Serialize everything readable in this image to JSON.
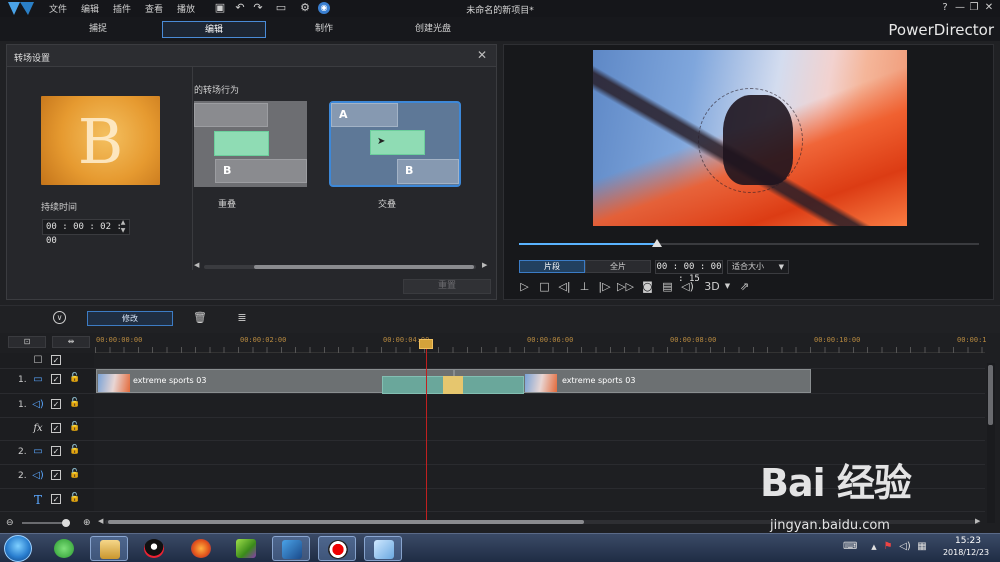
{
  "menu": {
    "items": [
      "文件",
      "编辑",
      "插件",
      "查看",
      "播放"
    ],
    "window_title": "未命名的新项目*",
    "help": "?"
  },
  "modes": {
    "tabs": [
      "捕捉",
      "编辑",
      "制作",
      "创建光盘"
    ],
    "active": "编辑",
    "brand": "PowerDirector"
  },
  "transition_panel": {
    "title": "转场设置",
    "thumb_letter": "B",
    "duration_label": "持续时间",
    "duration_value": "00 : 00 : 02 : 00",
    "behavior_label": "的转场行为",
    "cards": [
      {
        "label": "重叠",
        "block_top": "",
        "block_bottom": "B"
      },
      {
        "label": "交叠",
        "block_top": "A",
        "block_bottom": "B"
      }
    ],
    "selected": "交叠",
    "reset_label": "重置"
  },
  "preview": {
    "progress_fraction": 0.3,
    "mode_clip": "片段",
    "mode_movie": "全片",
    "active_mode": "片段",
    "timecode": "00 : 00 : 00 : 15",
    "fit_label": "适合大小",
    "three_d_label": "3D"
  },
  "toolbar": {
    "modify_label": "修改"
  },
  "timeline": {
    "ticks": [
      "00:00:00:00",
      "00:00:02:00",
      "00:00:04:00",
      "00:00:06:00",
      "00:00:08:00",
      "00:00:10:00",
      "00:00:1"
    ],
    "tracks": [
      {
        "num": "",
        "icon": "video-track-icon"
      },
      {
        "num": "1.",
        "icon": "video-track-icon"
      },
      {
        "num": "1.",
        "icon": "audio-track-icon"
      },
      {
        "num": "",
        "icon": "fx-track-icon",
        "glyph": "fx"
      },
      {
        "num": "2.",
        "icon": "video-track-icon"
      },
      {
        "num": "2.",
        "icon": "audio-track-icon"
      },
      {
        "num": "",
        "icon": "title-track-icon",
        "glyph": "T"
      }
    ],
    "clips": [
      {
        "name": "extreme sports 03"
      },
      {
        "name": "extreme sports 03"
      }
    ]
  },
  "taskbar": {
    "time": "15:23",
    "date": "2018/12/23"
  },
  "watermark": {
    "text": "Bai 经验",
    "url": "jingyan.baidu.com"
  },
  "colors": {
    "accent": "#3d88d8",
    "playhead": "#c02020",
    "transition_block": "#6aa79b"
  }
}
